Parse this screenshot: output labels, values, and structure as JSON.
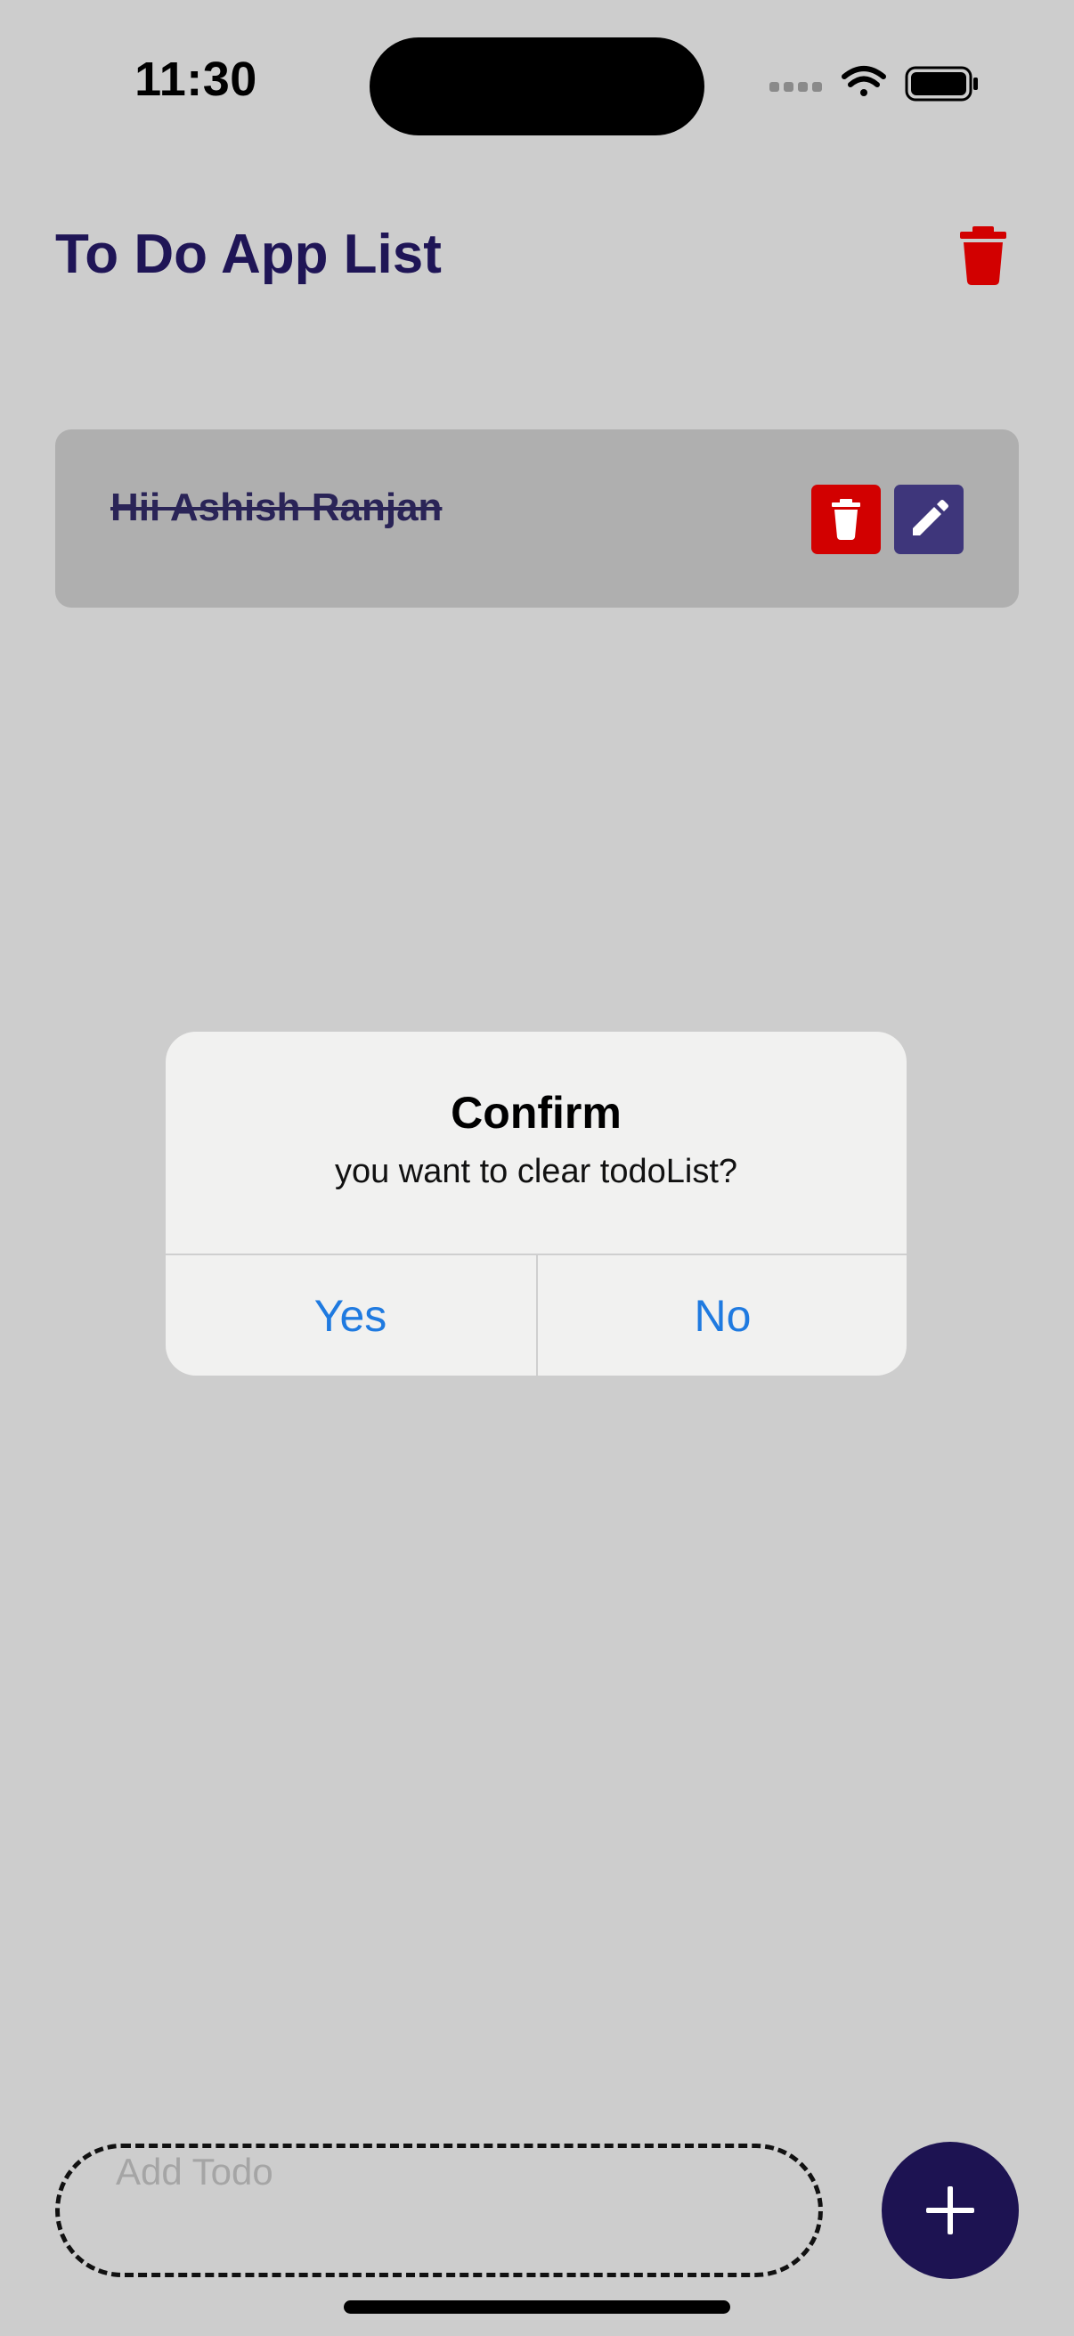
{
  "status_bar": {
    "time": "11:30",
    "icons": [
      "signal-dots-icon",
      "wifi-icon",
      "battery-icon"
    ]
  },
  "header": {
    "title": "To Do App List",
    "clear_icon": "trash-icon"
  },
  "todos": [
    {
      "text": "Hii Ashish Ranjan",
      "completed": true,
      "delete_icon": "trash-icon",
      "edit_icon": "pencil-icon"
    }
  ],
  "alert": {
    "title": "Confirm",
    "message": "you want to clear todoList?",
    "yes_label": "Yes",
    "no_label": "No"
  },
  "input": {
    "placeholder": "Add Todo",
    "value": "",
    "add_icon": "plus-icon"
  },
  "colors": {
    "background": "#cdcdcd",
    "title": "#1f1556",
    "danger": "#d20000",
    "edit": "#3e367b",
    "accent": "#1d1352",
    "alert_button": "#1f7ae0"
  }
}
